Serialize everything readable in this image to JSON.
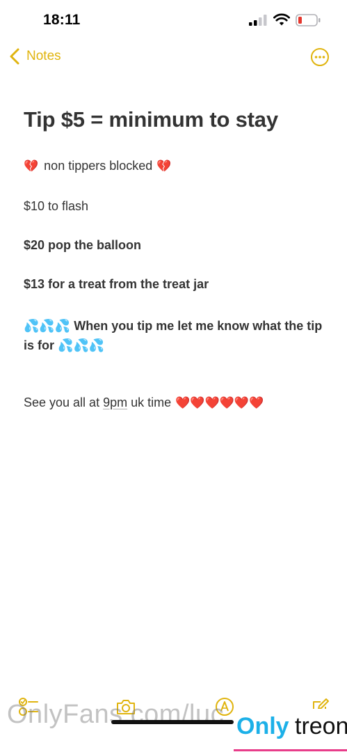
{
  "status_bar": {
    "time": "18:11",
    "battery_color": "#e5362c"
  },
  "nav": {
    "back_label": "Notes",
    "accent": "#e0b40e"
  },
  "note": {
    "title": "Tip $5 = minimum to stay",
    "line1_text": "non tippers blocked",
    "line1_emoji": "💔",
    "line2": "$10 to flash",
    "line3": "$20 pop the balloon",
    "line4": "$13 for a treat from the treat jar",
    "line5_emoji": "💦💦💦",
    "line5_text": "When you tip me let me know what the tip is for",
    "line6_prefix": "See you all at ",
    "line6_time": "9pm",
    "line6_suffix": " uk time",
    "line6_emoji": "❤️❤️❤️❤️❤️❤️"
  },
  "toolbar": {
    "icons": [
      "checklist-icon",
      "camera-icon",
      "markup-icon",
      "compose-icon"
    ]
  },
  "watermark": {
    "left": "OnlyFans.com/luc",
    "right_part1": "Only",
    "right_part2": "treon"
  }
}
